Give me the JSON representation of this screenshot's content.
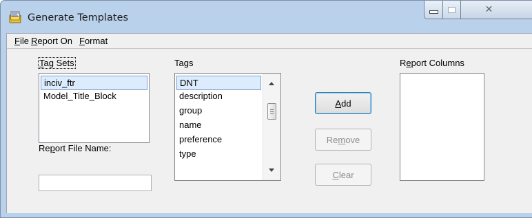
{
  "window": {
    "title": "Generate Templates",
    "icon": "app-icon"
  },
  "caption_buttons": [
    "minimize-icon",
    "maximize-icon",
    "close-icon"
  ],
  "menu": {
    "file": {
      "pre": "",
      "key": "F",
      "post": "ile"
    },
    "report_on": {
      "pre": "",
      "key": "R",
      "post": "eport On"
    },
    "format": {
      "pre": "",
      "key": "F",
      "post": "ormat"
    }
  },
  "tag_sets": {
    "label_key": "T",
    "label_rest": "ag Sets",
    "items": [
      "inciv_ftr",
      "Model_Title_Block"
    ],
    "selected": "inciv_ftr"
  },
  "tags": {
    "label_pre": "Ta",
    "label_key": "g",
    "label_post": "s",
    "items": [
      "DNT",
      "description",
      "group",
      "name",
      "preference",
      "type"
    ],
    "selected": "DNT"
  },
  "report_columns": {
    "label_pre": "R",
    "label_key": "e",
    "label_post": "port Columns",
    "items": []
  },
  "report_file_name": {
    "label_pre": "Re",
    "label_key": "p",
    "label_post": "ort File Name:",
    "value": ""
  },
  "buttons": {
    "add": {
      "pre": "",
      "key": "A",
      "post": "dd",
      "enabled": true
    },
    "remove": {
      "pre": "Re",
      "key": "m",
      "post": "ove",
      "enabled": false
    },
    "clear": {
      "pre": "",
      "key": "C",
      "post": "lear",
      "enabled": false
    }
  }
}
